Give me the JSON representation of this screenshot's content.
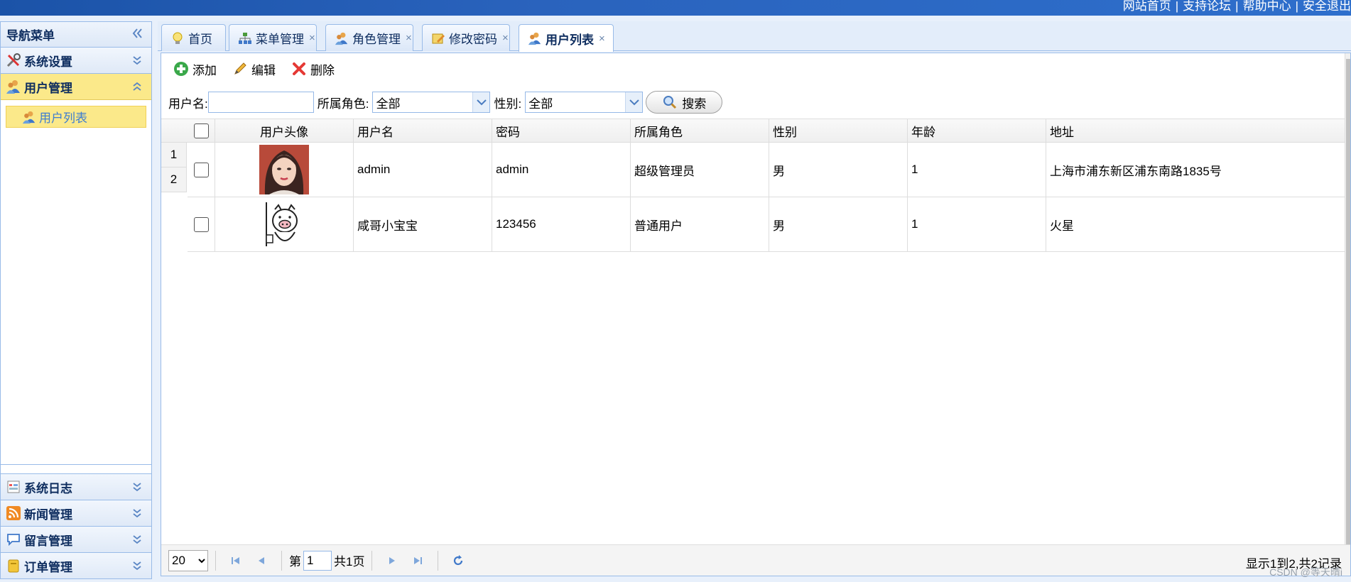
{
  "top_links": [
    "网站首页",
    "支持论坛",
    "帮助中心",
    "安全退出"
  ],
  "sidebar": {
    "title": "导航菜单",
    "sections": [
      {
        "label": "系统设置",
        "icon": "tools-icon"
      },
      {
        "label": "用户管理",
        "icon": "users-icon"
      }
    ],
    "active_sub_item": "用户列表",
    "bottom_sections": [
      {
        "label": "系统日志",
        "icon": "log-icon"
      },
      {
        "label": "新闻管理",
        "icon": "rss-icon"
      },
      {
        "label": "留言管理",
        "icon": "comment-icon"
      },
      {
        "label": "订单管理",
        "icon": "order-icon"
      }
    ]
  },
  "tabs": [
    {
      "label": "首页",
      "closable": false
    },
    {
      "label": "菜单管理",
      "closable": true
    },
    {
      "label": "角色管理",
      "closable": true
    },
    {
      "label": "修改密码",
      "closable": true
    },
    {
      "label": "用户列表",
      "closable": true
    }
  ],
  "tab_close_glyph": "×",
  "toolbar": {
    "add": "添加",
    "edit": "编辑",
    "delete": "删除"
  },
  "search": {
    "username_label": "用户名:",
    "username_value": "",
    "role_label": "所属角色:",
    "role_value": "全部",
    "gender_label": "性别:",
    "gender_value": "全部",
    "button": "搜索"
  },
  "grid": {
    "columns": [
      "用户头像",
      "用户名",
      "密码",
      "所属角色",
      "性别",
      "年龄",
      "地址"
    ],
    "rows": [
      {
        "num": "1",
        "avatar": "photo",
        "username": "admin",
        "password": "admin",
        "role": "超级管理员",
        "gender": "男",
        "age": "1",
        "address": "上海市浦东新区浦东南路1835号"
      },
      {
        "num": "2",
        "avatar": "pig-cartoon",
        "username": "咸哥小宝宝",
        "password": "123456",
        "role": "普通用户",
        "gender": "男",
        "age": "1",
        "address": "火星"
      }
    ]
  },
  "pager": {
    "page_size": "20",
    "page_prefix": "第",
    "page_value": "1",
    "page_total": "共1页",
    "info": "显示1到2,共2记录"
  },
  "watermark": "CSDN @等天晴i",
  "colors": {
    "accent": "#99bbe8",
    "active_yellow": "#fbe98a",
    "banner_blue": "#1b53a8"
  }
}
